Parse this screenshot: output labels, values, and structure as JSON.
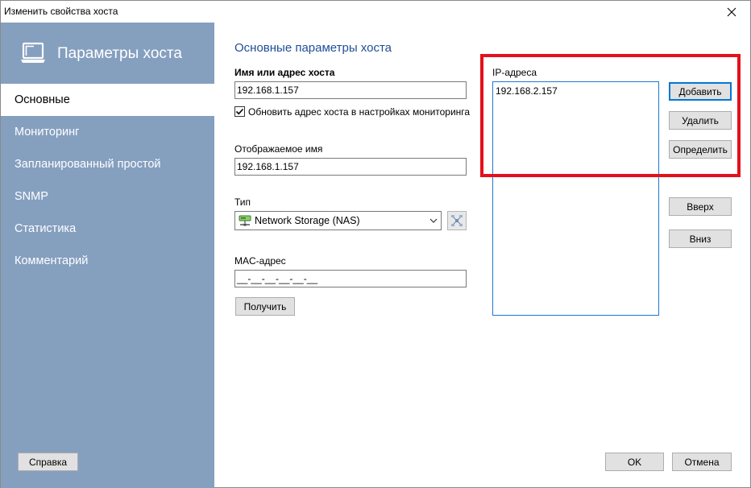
{
  "window": {
    "title": "Изменить свойства хоста"
  },
  "sidebar": {
    "title": "Параметры хоста",
    "icon": "laptop-icon",
    "items": [
      {
        "label": "Основные",
        "active": true
      },
      {
        "label": "Мониторинг",
        "active": false
      },
      {
        "label": "Запланированный простой",
        "active": false
      },
      {
        "label": "SNMP",
        "active": false
      },
      {
        "label": "Статистика",
        "active": false
      },
      {
        "label": "Комментарий",
        "active": false
      }
    ],
    "help_label": "Справка"
  },
  "main": {
    "section_title": "Основные параметры хоста",
    "host_label": "Имя или адрес хоста",
    "host_value": "192.168.1.157",
    "update_checkbox_label": "Обновить адрес хоста в настройках мониторинга",
    "update_checked": true,
    "display_name_label": "Отображаемое имя",
    "display_name_value": "192.168.1.157",
    "type_label": "Тип",
    "type_value": "Network Storage (NAS)",
    "mac_label": "MAC-адрес",
    "mac_value": "__-__-__-__-__-__",
    "get_button_label": "Получить"
  },
  "ip": {
    "label": "IP-адреса",
    "addresses": [
      "192.168.2.157"
    ],
    "add_label": "Добавить",
    "delete_label": "Удалить",
    "detect_label": "Определить",
    "up_label": "Вверх",
    "down_label": "Вниз"
  },
  "footer": {
    "ok_label": "OK",
    "cancel_label": "Отмена"
  },
  "colors": {
    "sidebar_bg": "#859fbf",
    "section_title": "#1f4e96",
    "highlight": "#e3111b",
    "list_border": "#1e78d4"
  }
}
